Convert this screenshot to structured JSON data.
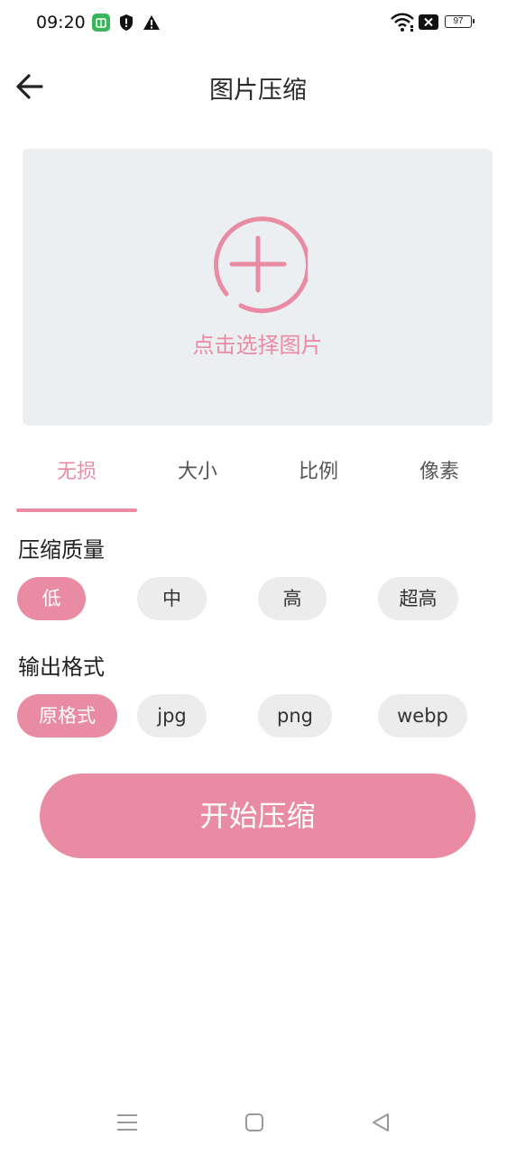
{
  "status_bar": {
    "time": "09:20",
    "battery_level": "97",
    "icons": [
      "app-notification-icon",
      "shield-icon",
      "warning-icon",
      "wifi-icon",
      "sim-off-icon",
      "battery-icon"
    ]
  },
  "header": {
    "title": "图片压缩",
    "back_icon": "arrow-left-icon"
  },
  "picker": {
    "label": "点击选择图片",
    "icon": "add-circle-icon"
  },
  "tabs": [
    {
      "label": "无损",
      "active": true
    },
    {
      "label": "大小",
      "active": false
    },
    {
      "label": "比例",
      "active": false
    },
    {
      "label": "像素",
      "active": false
    }
  ],
  "quality": {
    "title": "压缩质量",
    "options": [
      "低",
      "中",
      "高",
      "超高"
    ],
    "selected": "低"
  },
  "format": {
    "title": "输出格式",
    "options": [
      "原格式",
      "jpg",
      "png",
      "webp"
    ],
    "selected": "原格式"
  },
  "actions": {
    "start_label": "开始压缩"
  },
  "colors": {
    "accent": "#ea8ba4",
    "picker_bg": "#eceff2",
    "chip_bg": "#ececec"
  },
  "nav": [
    "menu-icon",
    "home-icon",
    "back-triangle-icon"
  ]
}
